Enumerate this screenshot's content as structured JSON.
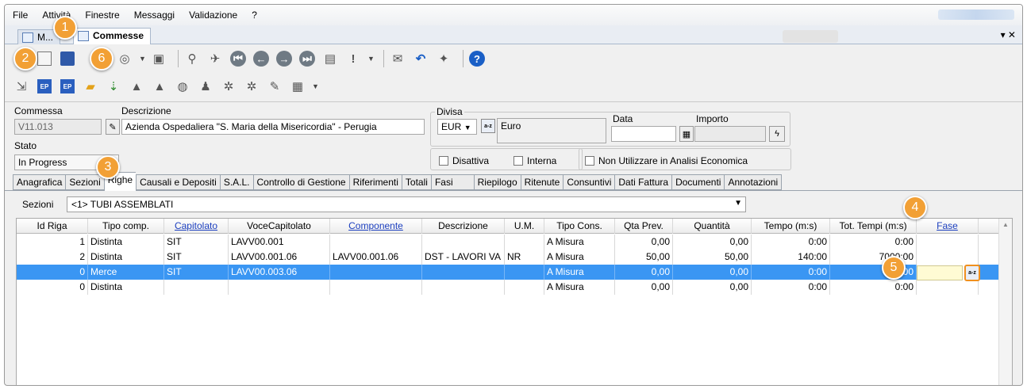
{
  "menu": {
    "items": [
      "File",
      "Attività",
      "Finestre",
      "Messaggi",
      "Validazione",
      "?"
    ]
  },
  "doc_tabs": {
    "items": [
      {
        "label": "M..."
      },
      {
        "label": "Commesse"
      }
    ],
    "controls": "▾ ✕"
  },
  "header": {
    "commessa_label": "Commessa",
    "commessa_value": "V11.013",
    "descrizione_label": "Descrizione",
    "descrizione_value": "Azienda Ospedaliera \"S. Maria della Misericordia\" - Perugia",
    "stato_label": "Stato",
    "stato_value": "In Progress",
    "divisa_label": "Divisa",
    "divisa_value": "EUR",
    "divisa_desc": "Euro",
    "data_label": "Data",
    "data_value": "",
    "importo_label": "Importo",
    "importo_value": "",
    "disattiva_label": "Disattiva",
    "interna_label": "Interna",
    "non_utilizzare_label": "Non Utilizzare in Analisi Economica",
    "a2_glyph": "a-z"
  },
  "tabs": [
    "Anagrafica",
    "Sezioni",
    "Righe",
    "Causali e Depositi",
    "S.A.L.",
    "Controllo di Gestione",
    "Riferimenti",
    "Totali",
    "Fasi",
    "Riepilogo",
    "Ritenute",
    "Consuntivi",
    "Dati Fattura",
    "Documenti",
    "Annotazioni"
  ],
  "active_tab": "Righe",
  "sezioni": {
    "label": "Sezioni",
    "value": "<1> TUBI ASSEMBLATI"
  },
  "grid": {
    "columns": [
      "Id Riga",
      "Tipo comp.",
      "Capitolato",
      "VoceCapitolato",
      "Componente",
      "Descrizione",
      "U.M.",
      "Tipo Cons.",
      "Qta Prev.",
      "Quantità",
      "Tempo (m:s)",
      "Tot. Tempi (m:s)",
      "Fase"
    ],
    "rows": [
      [
        "1",
        "Distinta",
        "SIT",
        "LAVV00.001",
        "",
        "",
        "",
        "A Misura",
        "0,00",
        "0,00",
        "0:00",
        "0:00",
        ""
      ],
      [
        "2",
        "Distinta",
        "SIT",
        "LAVV00.001.06",
        "LAVV00.001.06",
        "DST - LAVORI VA",
        "NR",
        "A Misura",
        "50,00",
        "50,00",
        "140:00",
        "7000:00",
        ""
      ],
      [
        "0",
        "Merce",
        "SIT",
        "LAVV00.003.06",
        "",
        "",
        "",
        "A Misura",
        "0,00",
        "0,00",
        "0:00",
        "0:00",
        ""
      ],
      [
        "0",
        "Distinta",
        "",
        "",
        "",
        "",
        "",
        "A Misura",
        "0,00",
        "0,00",
        "0:00",
        "0:00",
        ""
      ]
    ],
    "selected_row": 2
  },
  "callouts": [
    "1",
    "2",
    "3",
    "4",
    "5",
    "6"
  ],
  "colors": {
    "callout": "#f2a035",
    "selection": "#3a96f3",
    "link": "#1c3fbf"
  }
}
